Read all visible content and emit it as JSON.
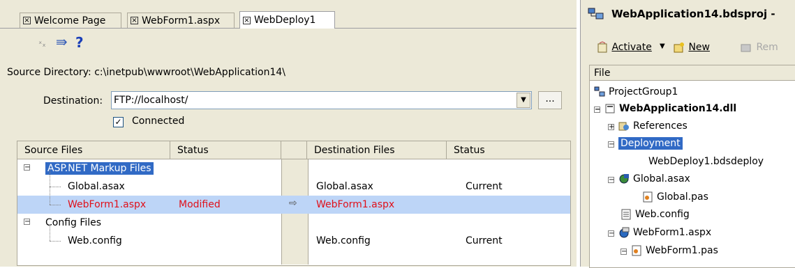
{
  "tabs": [
    {
      "label": "Welcome Page"
    },
    {
      "label": "WebForm1.aspx"
    },
    {
      "label": "WebDeploy1"
    }
  ],
  "toolbar": {
    "help_label": "?"
  },
  "source_directory_label": "Source Directory: c:\\inetpub\\wwwroot\\WebApplication14\\",
  "destination": {
    "label": "Destination:",
    "value": "FTP://localhost/",
    "browse_label": "..."
  },
  "connected": {
    "label": "Connected",
    "checked": true
  },
  "grid": {
    "headers": [
      "Source Files",
      "Status",
      "Destination Files",
      "Status"
    ],
    "rows": [
      {
        "source": "ASP.NET Markup Files",
        "status": "",
        "dest": "",
        "dest_status": ""
      },
      {
        "source": "Global.asax",
        "status": "",
        "dest": "Global.asax",
        "dest_status": "Current"
      },
      {
        "source": "WebForm1.aspx",
        "status": "Modified",
        "dest": "WebForm1.aspx",
        "dest_status": ""
      },
      {
        "source": "Config Files",
        "status": "",
        "dest": "",
        "dest_status": ""
      },
      {
        "source": "Web.config",
        "status": "",
        "dest": "Web.config",
        "dest_status": "Current"
      }
    ]
  },
  "project_manager": {
    "title": "WebApplication14.bdsproj -",
    "activate_label": "Activate",
    "new_label": "New",
    "remove_label": "Rem",
    "column_header": "File",
    "nodes": [
      "ProjectGroup1",
      "WebApplication14.dll",
      "References",
      "Deployment",
      "WebDeploy1.bdsdeploy",
      "Global.asax",
      "Global.pas",
      "Web.config",
      "WebForm1.aspx",
      "WebForm1.pas"
    ]
  },
  "colors": {
    "selection": "#316ac5",
    "row_highlight": "#bdd5f7",
    "modified": "#e0101a"
  }
}
